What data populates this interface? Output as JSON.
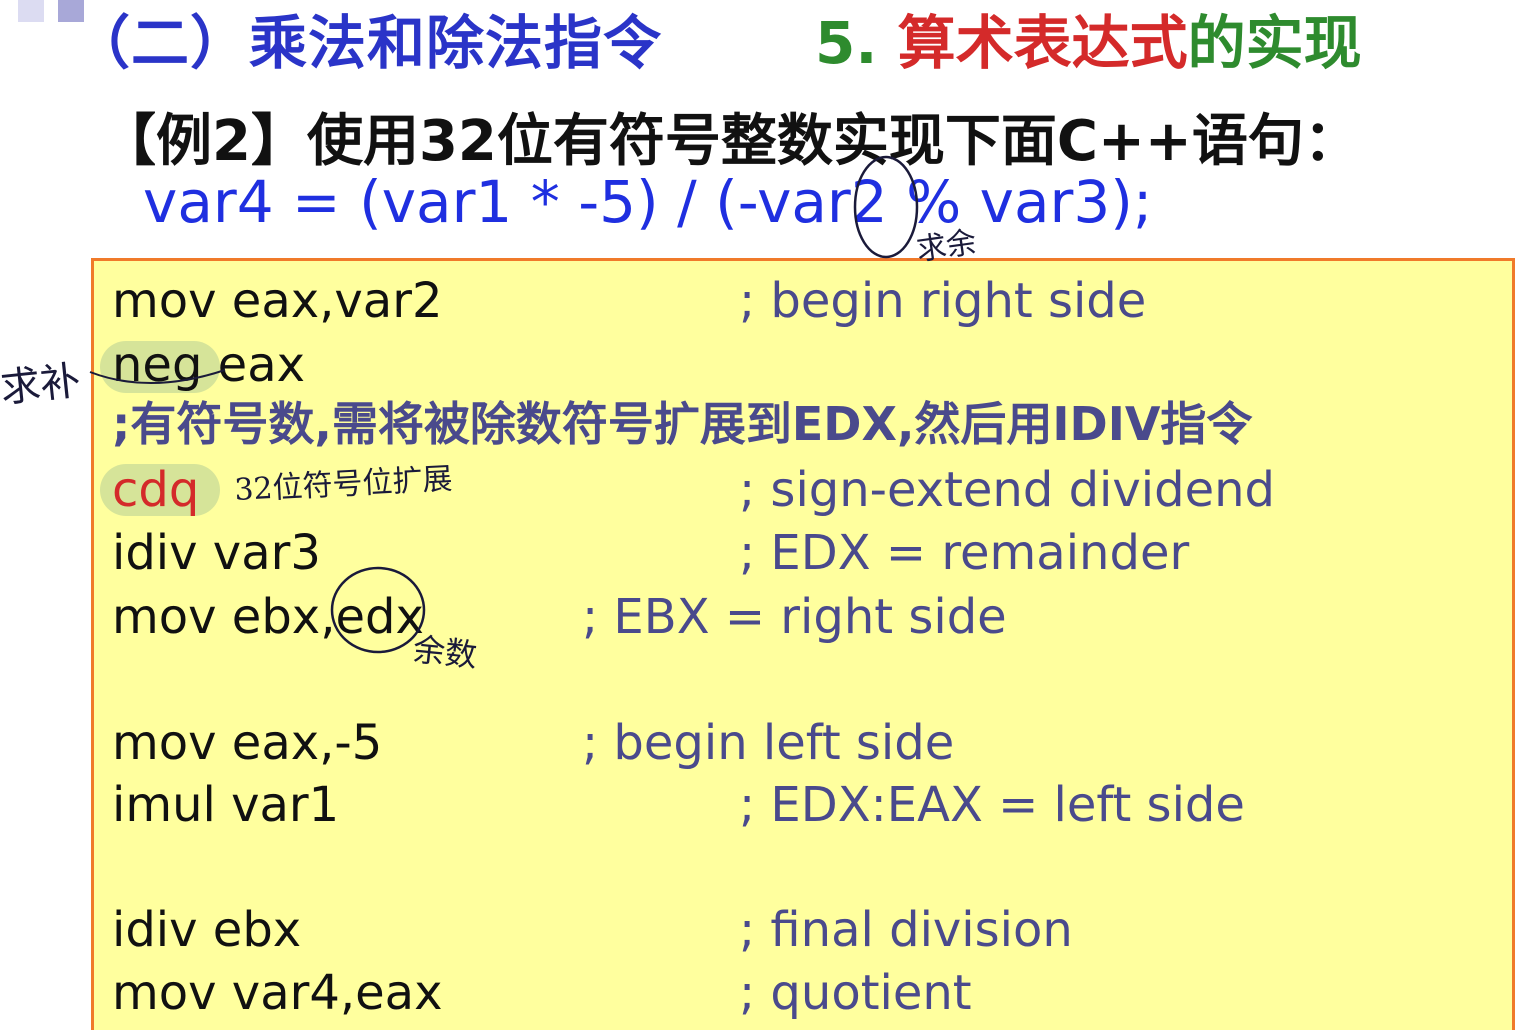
{
  "header": {
    "section_title": "（二）乘法和除法指令",
    "topic_number": "5. ",
    "topic_part1": "算术表达式",
    "topic_part2": "的实现"
  },
  "example": {
    "heading": "【例2】使用32位有符号整数实现下面C++语句：",
    "cpp_statement": "var4 = (var1 * -5) / (-var2 % var3);"
  },
  "code": {
    "lines": [
      {
        "instr": "mov   eax,var2",
        "comment": "; begin right side"
      },
      {
        "instr": "neg  eax",
        "comment": ""
      },
      {
        "instr": "",
        "comment": ";有符号数,需将被除数符号扩展到EDX,然后用IDIV指令"
      },
      {
        "instr": "cdq",
        "comment": "; sign-extend dividend"
      },
      {
        "instr": "idiv var3",
        "comment": "; EDX = remainder"
      },
      {
        "instr": "mov   ebx,edx",
        "comment": "; EBX = right side"
      },
      {
        "instr": "mov   eax,-5",
        "comment": "; begin left side"
      },
      {
        "instr": "imul var1",
        "comment": "; EDX:EAX = left side"
      },
      {
        "instr": "idiv ebx",
        "comment": "; final division"
      },
      {
        "instr": "mov   var4,eax",
        "comment": "; quotient"
      }
    ]
  },
  "annotations": {
    "percent_note": "求余",
    "neg_note": "求补",
    "cdq_note": "32位符号位扩展",
    "edx_note": "余数"
  },
  "colors": {
    "title_blue": "#2a34c8",
    "topic_red": "#d42a2a",
    "topic_green": "#2e8b2e",
    "code_box_fill": "#ffff9e",
    "code_box_border": "#f07a2a",
    "comment_color": "#4a4a8c"
  }
}
